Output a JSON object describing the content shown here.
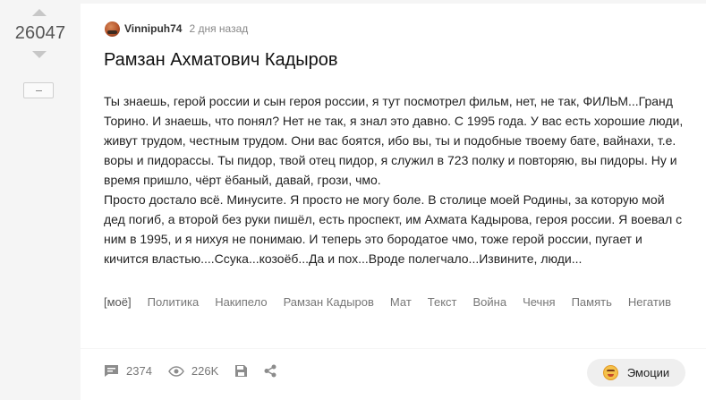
{
  "vote": {
    "rating": "26047"
  },
  "post": {
    "author": "Vinnipuh74",
    "time": "2 дня назад",
    "title": "Рамзан Ахматович Кадыров",
    "paragraphs": [
      "Ты знаешь, герой россии и сын героя россии, я тут посмотрел фильм, нет, не так, ФИЛЬМ...Гранд Торино. И знаешь, что понял? Нет не так, я знал это давно. С 1995 года. У вас есть хорошие люди, живут трудом, честным трудом. Они вас боятся, ибо вы, ты и подобные твоему бате, вайнахи, т.е. воры и пидорассы. Ты пидор, твой отец пидор, я служил в 723 полку и повторяю, вы пидоры. Ну и время пришло, чёрт ёбаный, давай, грози, чмо.",
      "Просто достало всё. Минусите. Я просто не могу боле. В столице моей Родины, за которую мой дед погиб, а второй без руки пишёл, есть проспект, им Ахмата Кадырова, героя россии. Я воевал с ним в 1995, и я нихуя не понимаю. И теперь это бородатое чмо, тоже герой россии, пугает и кичится властью....Ссука...козоёб...Да и пох...Вроде полегчало...Извините, люди..."
    ],
    "tags": [
      "[моё]",
      "Политика",
      "Накипело",
      "Рамзан Кадыров",
      "Мат",
      "Текст",
      "Война",
      "Чечня",
      "Память",
      "Негатив"
    ]
  },
  "footer": {
    "comments": "2374",
    "views": "226K",
    "emotions_label": "Эмоции"
  },
  "colors": {
    "background": "#f5f5f5",
    "card": "#ffffff",
    "muted_text": "#777777",
    "emotion_button": "#efefef"
  },
  "icons": {
    "upvote": "upvote-arrow-icon",
    "downvote": "downvote-arrow-icon",
    "minus": "minus-icon",
    "comment": "comment-icon",
    "views": "eye-icon",
    "save": "save-icon",
    "share": "share-icon",
    "emotion": "emotion-face-icon"
  }
}
